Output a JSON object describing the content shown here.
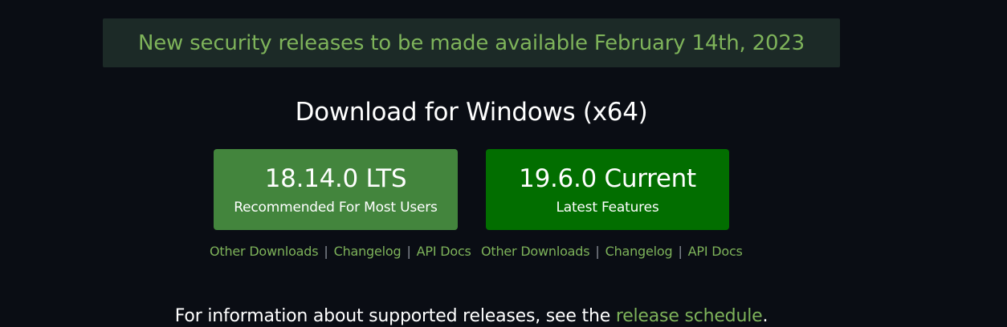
{
  "banner": {
    "text": "New security releases to be made available February 14th, 2023"
  },
  "page_title": "Download for Windows (x64)",
  "downloads": {
    "lts": {
      "version": "18.14.0 LTS",
      "subtitle": "Recommended For Most Users",
      "links": {
        "other_downloads": "Other Downloads",
        "changelog": "Changelog",
        "api_docs": "API Docs"
      }
    },
    "current": {
      "version": "19.6.0 Current",
      "subtitle": "Latest Features",
      "links": {
        "other_downloads": "Other Downloads",
        "changelog": "Changelog",
        "api_docs": "API Docs"
      }
    },
    "separator": "|"
  },
  "info": {
    "text_before": "For information about supported releases, see the ",
    "link_text": "release schedule",
    "text_after": "."
  },
  "colors": {
    "background": "#0a0d14",
    "banner_background": "#1c2a27",
    "accent_green": "#7eb35a",
    "lts_button": "#43853d",
    "current_button": "#026e00"
  }
}
